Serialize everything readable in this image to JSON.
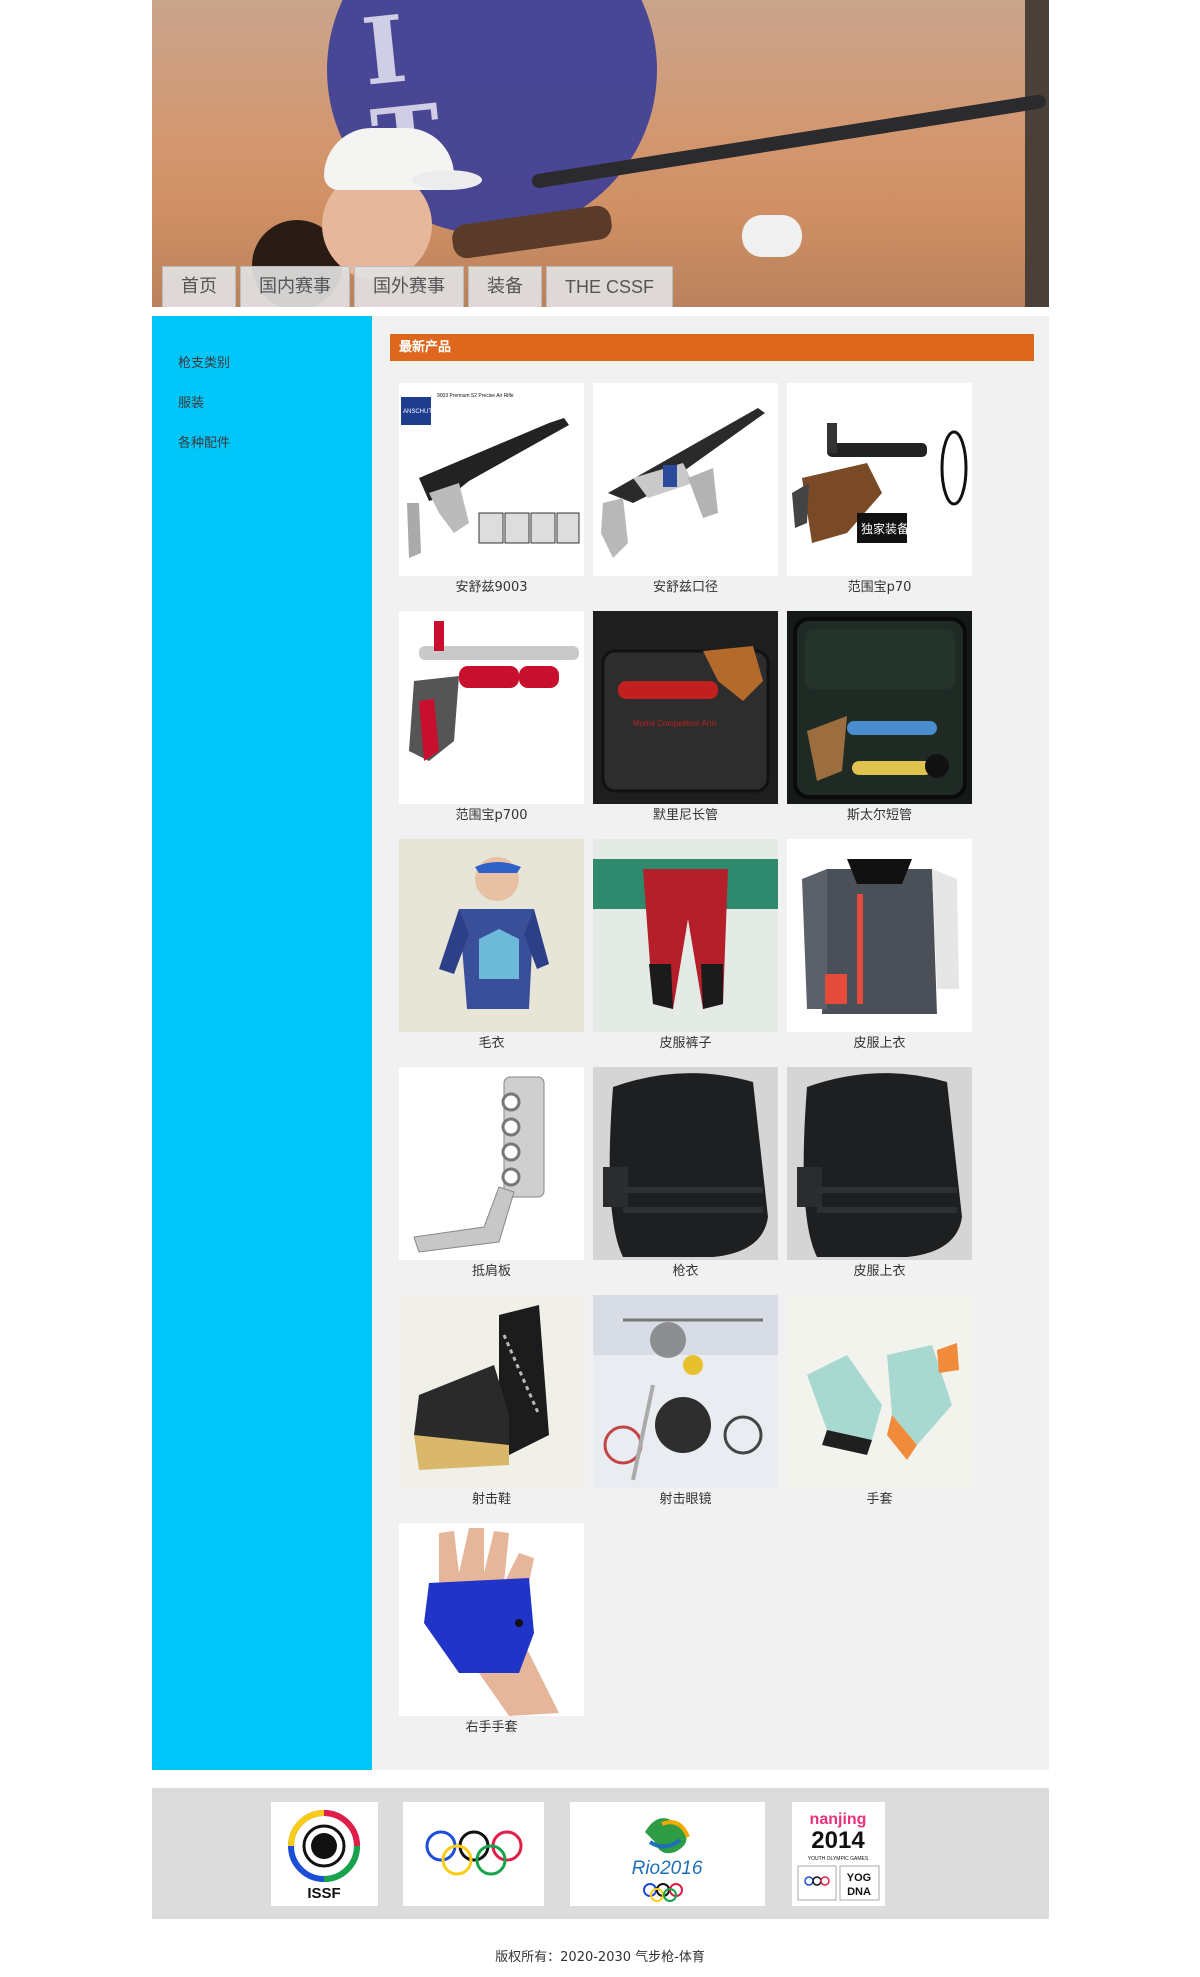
{
  "nav": {
    "tabs": [
      {
        "label": "首页"
      },
      {
        "label": "国内赛事"
      },
      {
        "label": "国外赛事"
      },
      {
        "label": "装备"
      },
      {
        "label": "THE CSSF"
      }
    ]
  },
  "sidebar": {
    "items": [
      {
        "label": "枪支类别"
      },
      {
        "label": "服装"
      },
      {
        "label": "各种配件"
      }
    ]
  },
  "section": {
    "title": "最新产品"
  },
  "products": [
    {
      "name": "安舒兹9003"
    },
    {
      "name": "安舒兹口径"
    },
    {
      "name": "范围宝p70"
    },
    {
      "name": "范围宝p700"
    },
    {
      "name": "默里尼长管"
    },
    {
      "name": "斯太尔短管"
    },
    {
      "name": "毛衣"
    },
    {
      "name": "皮服裤子"
    },
    {
      "name": "皮服上衣"
    },
    {
      "name": "抵肩板"
    },
    {
      "name": "枪衣"
    },
    {
      "name": "皮服上衣"
    },
    {
      "name": "射击鞋"
    },
    {
      "name": "射击眼镜"
    },
    {
      "name": "手套"
    },
    {
      "name": "右手手套"
    }
  ],
  "product_images": {
    "p1_header": "9003 Premium S2 Precise Air Rifle",
    "p1_brand": "ANSCHUTZ",
    "p3_mark": "独家装备",
    "p5_label": "Morini Competition Arm"
  },
  "logos": {
    "issf": "ISSF",
    "rio": "Rio2016",
    "nanjing_name": "nanjing",
    "nanjing_year": "2014",
    "nanjing_sub": "YOUTH OLYMPIC GAMES",
    "yog": "YOG",
    "dna": "DNA"
  },
  "footer": {
    "copyright": "版权所有：2020-2030 气步枪-体育"
  }
}
